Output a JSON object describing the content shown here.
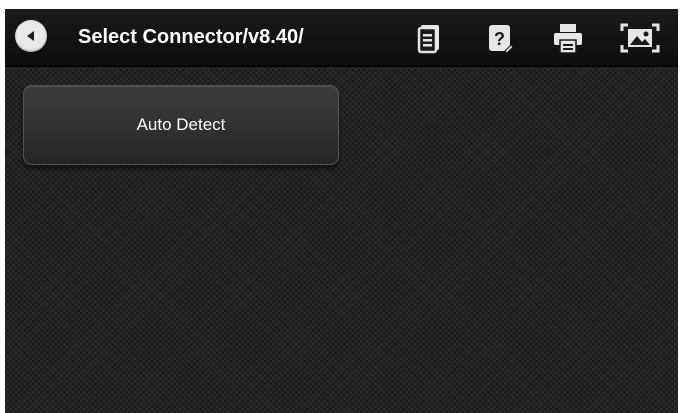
{
  "header": {
    "title": "Select Connector/v8.40/"
  },
  "toolbar": {
    "icons": [
      "document-list-icon",
      "help-icon",
      "print-icon",
      "screenshot-icon"
    ]
  },
  "main": {
    "buttons": [
      {
        "label": "Auto Detect"
      }
    ]
  },
  "colors": {
    "background": "#2a2a2a",
    "topbar": "#111111",
    "button": "#333333",
    "text": "#ffffff"
  }
}
